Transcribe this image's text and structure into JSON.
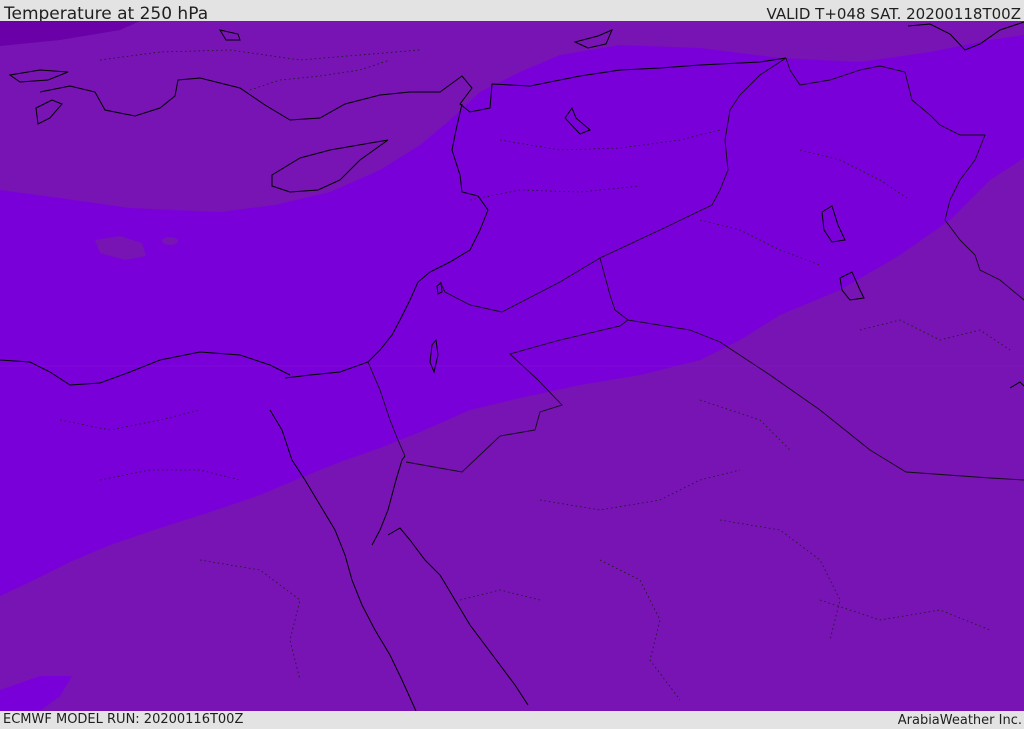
{
  "header": {
    "title": "Temperature at 250 hPa",
    "valid": "VALID T+048 SAT. 20200118T00Z"
  },
  "footer": {
    "model_run": "ECMWF MODEL RUN: 20200116T00Z",
    "credit": "ArabiaWeather Inc."
  },
  "map": {
    "colors": {
      "warm_fill": "#7813b4",
      "cold_fill": "#7a00d9",
      "coldest_fill": "#6a00a8",
      "coastline": "#000000",
      "border": "#111111"
    }
  }
}
